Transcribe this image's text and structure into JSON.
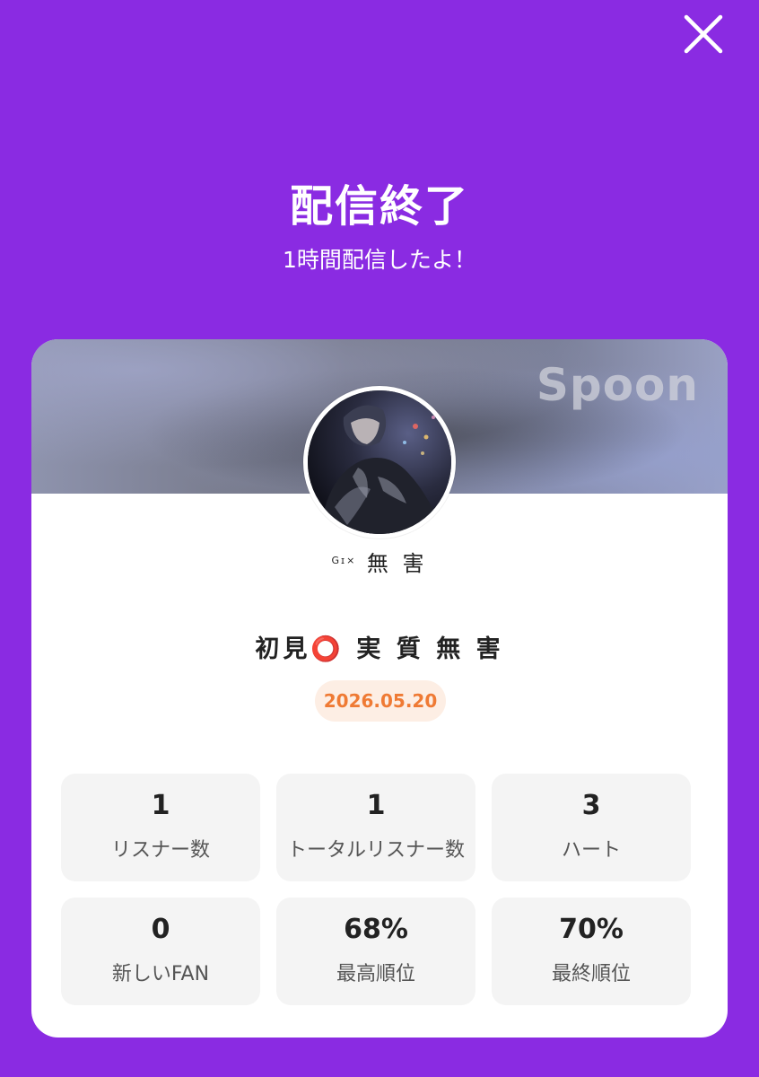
{
  "header": {
    "title": "配信終了",
    "subtitle": "1時間配信したよ！"
  },
  "card": {
    "logo_text": "Spoon",
    "username_prefix": "Gɪ",
    "username_marks": "×",
    "username_name": "無 害",
    "live_title": "初見⭕️ 実 質 無 害",
    "date": "2026.05.20"
  },
  "stats": [
    {
      "value": "1",
      "label": "リスナー数"
    },
    {
      "value": "1",
      "label": "トータルリスナー数"
    },
    {
      "value": "3",
      "label": "ハート"
    },
    {
      "value": "0",
      "label": "新しいFAN"
    },
    {
      "value": "68%",
      "label": "最高順位"
    },
    {
      "value": "70%",
      "label": "最終順位"
    }
  ],
  "colors": {
    "background": "#8a2be2",
    "card": "#ffffff",
    "date_badge_bg": "#fdeee4",
    "date_badge_text": "#ef7a34",
    "stat_bg": "#f4f4f4"
  },
  "icons": {
    "close": "close-icon",
    "avatar": "avatar"
  }
}
